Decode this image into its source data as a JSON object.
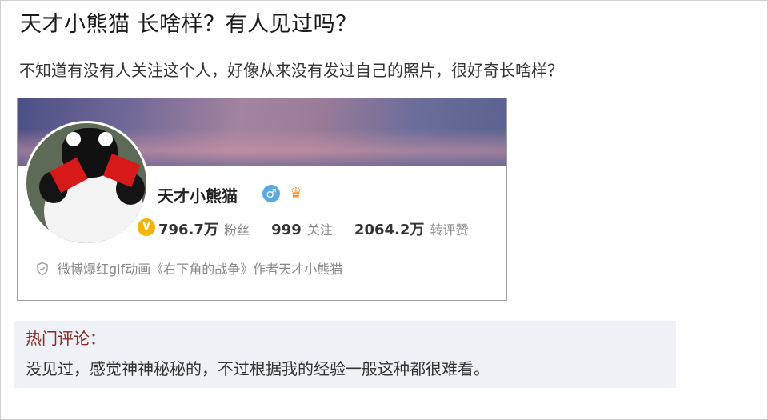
{
  "question": {
    "title": "天才小熊猫 长啥样？有人见过吗？",
    "body": "不知道有没有人关注这个人，好像从来没有发过自己的照片，很好奇长啥样？"
  },
  "profile": {
    "name": "天才小熊猫",
    "verified_badge": "V",
    "gender_icon": "male-icon",
    "crown_icon": "crown-icon",
    "stats": [
      {
        "value": "796.7万",
        "label": "粉丝"
      },
      {
        "value": "999",
        "label": "关注"
      },
      {
        "value": "2064.2万",
        "label": "转评赞"
      }
    ],
    "description": "微博爆红gif动画《右下角的战争》作者天才小熊猫"
  },
  "comment": {
    "heading": "热门评论：",
    "text": "没见过，感觉神神秘秘的，不过根据我的经验一般这种都很难看。"
  },
  "colors": {
    "verified": "#f6b400",
    "gender": "#5aa9e6",
    "comment_heading": "#8b2a22",
    "comment_bg": "#eef1f6"
  }
}
